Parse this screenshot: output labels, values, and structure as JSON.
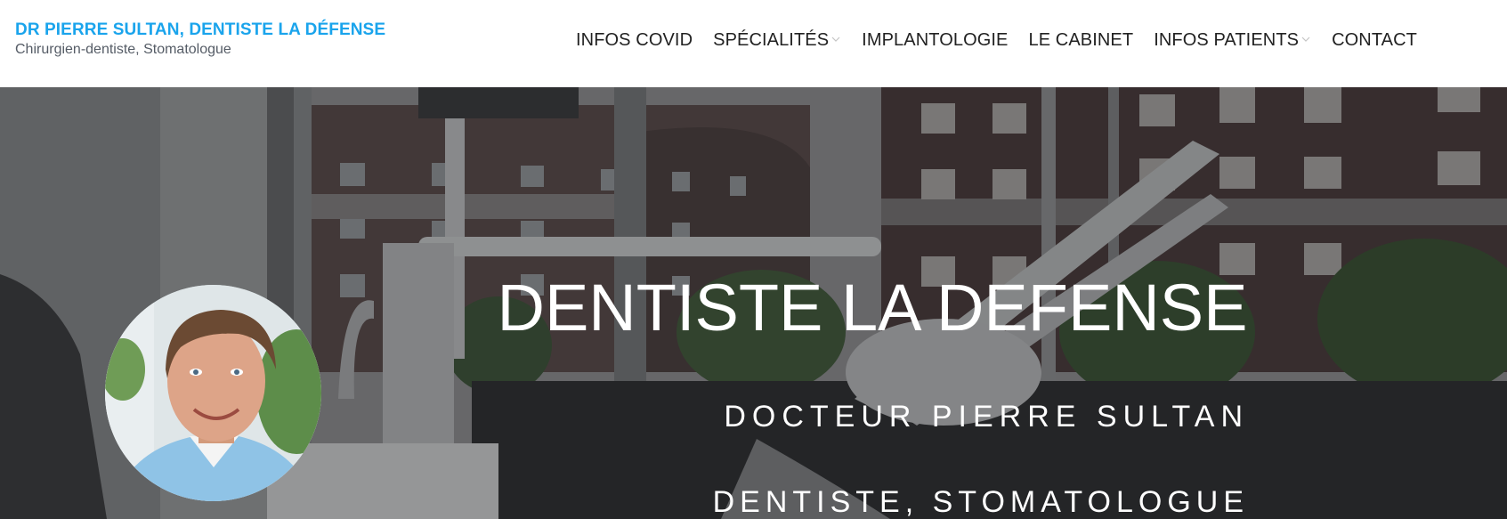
{
  "header": {
    "brand_title": "DR PIERRE SULTAN, DENTISTE LA DÉFENSE",
    "brand_subtitle": "Chirurgien-dentiste, Stomatologue",
    "nav": [
      {
        "label": "INFOS COVID",
        "has_dropdown": false
      },
      {
        "label": "SPÉCIALITÉS",
        "has_dropdown": true
      },
      {
        "label": "IMPLANTOLOGIE",
        "has_dropdown": false
      },
      {
        "label": "LE CABINET",
        "has_dropdown": false
      },
      {
        "label": "INFOS PATIENTS",
        "has_dropdown": true
      },
      {
        "label": "CONTACT",
        "has_dropdown": false
      }
    ]
  },
  "hero": {
    "title": "DENTISTE LA DEFENSE",
    "subtitle_1": "DOCTEUR PIERRE SULTAN",
    "subtitle_2": "DENTISTE, STOMATOLOGUE"
  },
  "colors": {
    "brand_blue": "#1aa4ec",
    "nav_text": "#222222",
    "subtitle_grey": "#555c66",
    "hero_text": "#ffffff"
  },
  "icons": {
    "dropdown": "chevron-down-icon"
  }
}
